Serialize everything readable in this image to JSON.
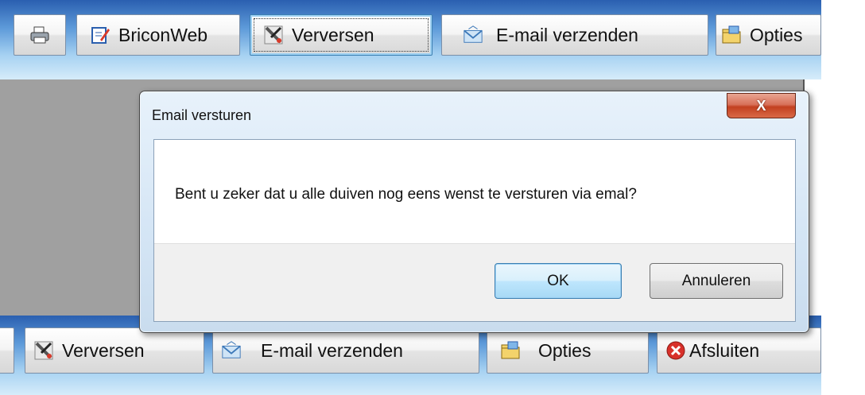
{
  "top_toolbar": {
    "print_icon": "printer-icon",
    "buttons": [
      {
        "label": "BriconWeb",
        "icon": "edit-document-icon"
      },
      {
        "label": "Verversen",
        "icon": "refresh-tools-icon"
      },
      {
        "label": "E-mail verzenden",
        "icon": "envelope-icon"
      },
      {
        "label": "Opties",
        "icon": "options-icon"
      }
    ]
  },
  "bottom_toolbar": {
    "buttons": [
      {
        "label": "Verversen",
        "icon": "refresh-tools-icon"
      },
      {
        "label": "E-mail verzenden",
        "icon": "envelope-icon"
      },
      {
        "label": "Opties",
        "icon": "options-icon"
      },
      {
        "label": "Afsluiten",
        "icon": "close-circle-icon"
      }
    ]
  },
  "dialog": {
    "title": "Email versturen",
    "close_symbol": "X",
    "message": "Bent u zeker dat u alle duiven nog eens wenst te versturen via emal?",
    "ok_label": "OK",
    "cancel_label": "Annuleren"
  },
  "colors": {
    "toolbar_top": "#2a5fb0",
    "toolbar_bottom": "#d6ecfa",
    "background_area": "#a0a0a0",
    "close_button": "#c2401f"
  }
}
